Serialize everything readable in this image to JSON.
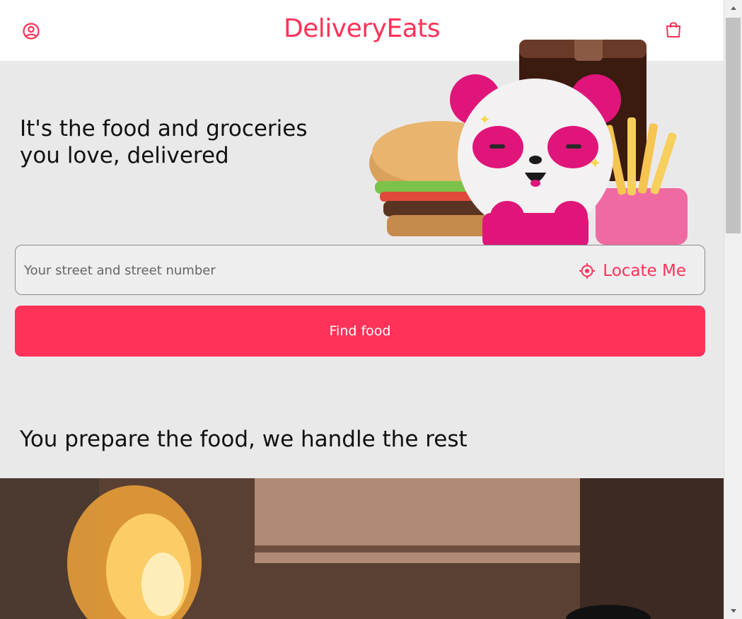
{
  "header": {
    "brand": "DeliveryEats",
    "profile_icon": "user-circle-icon",
    "cart_icon": "shopping-bag-icon"
  },
  "hero": {
    "title": "It's the food and groceries you love, delivered",
    "address_placeholder": "Your street and street number",
    "locate_label": "Locate Me",
    "locate_icon": "crosshair-icon",
    "find_button": "Find food"
  },
  "section": {
    "title": "You prepare the food, we handle the rest"
  },
  "colors": {
    "accent": "#ff3259",
    "hero_bg": "#eae9ea",
    "header_bg": "#ffffff"
  }
}
